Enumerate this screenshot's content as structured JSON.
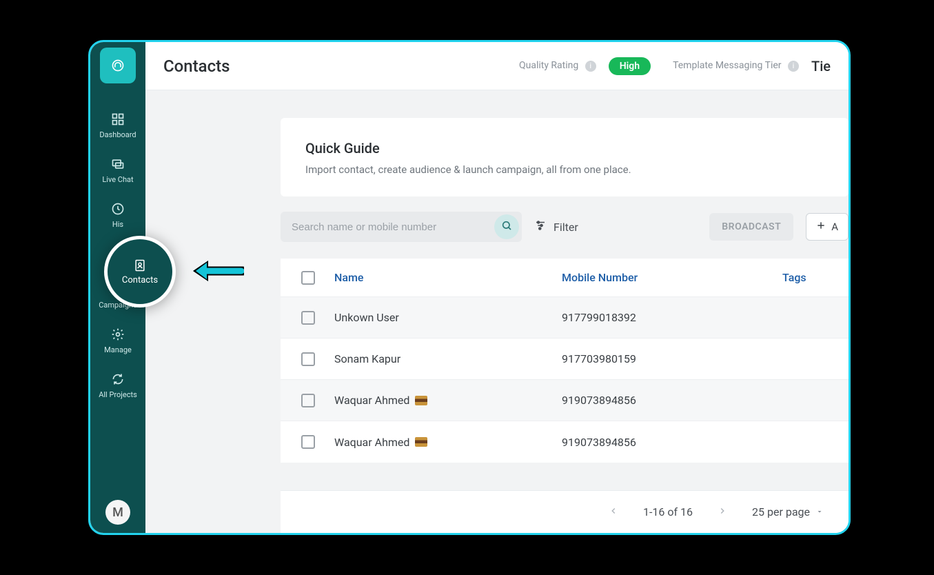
{
  "sidebar": {
    "items": [
      {
        "label": "Dashboard",
        "icon": "dashboard"
      },
      {
        "label": "Live Chat",
        "icon": "chat"
      },
      {
        "label": "History",
        "label_cut": "His",
        "icon": "history"
      },
      {
        "label": "Contacts",
        "icon": "contacts"
      },
      {
        "label": "Campaigns",
        "icon": "campaigns"
      },
      {
        "label": "Manage",
        "icon": "manage"
      },
      {
        "label": "All Projects",
        "icon": "projects"
      }
    ],
    "avatar_letter": "M"
  },
  "highlight": {
    "label": "Contacts"
  },
  "topbar": {
    "title": "Contacts",
    "quality_label": "Quality Rating",
    "quality_badge": "High",
    "tier_label": "Template Messaging Tier",
    "tier_cut": "Tie"
  },
  "guide": {
    "title": "Quick Guide",
    "subtitle": "Import contact, create audience & launch campaign, all from one place."
  },
  "toolbar": {
    "search_placeholder": "Search name or mobile number",
    "filter_label": "Filter",
    "broadcast_label": "BROADCAST",
    "add_label": "A"
  },
  "table": {
    "columns": {
      "name": "Name",
      "mobile": "Mobile Number",
      "tags": "Tags"
    },
    "rows": [
      {
        "name": "Unkown User",
        "mobile": "917799018392",
        "badge": false
      },
      {
        "name": "Sonam Kapur",
        "mobile": "917703980159",
        "badge": false
      },
      {
        "name": "Waquar Ahmed",
        "mobile": "919073894856",
        "badge": true
      },
      {
        "name": "Waquar Ahmed",
        "mobile": "919073894856",
        "badge": true
      }
    ]
  },
  "pager": {
    "range": "1-16 of 16",
    "per_page": "25 per page"
  }
}
